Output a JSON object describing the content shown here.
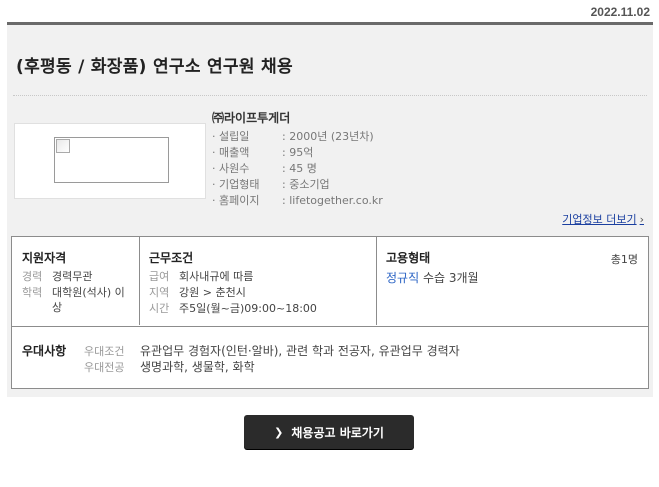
{
  "date": "2022.11.02",
  "job_title": "(후평동 / 화장품) 연구소 연구원 채용",
  "company": {
    "name": "㈜라이프투게더",
    "info": [
      {
        "label": "· 설립일",
        "value": ": 2000년 (23년차)"
      },
      {
        "label": "· 매출액",
        "value": ": 95억"
      },
      {
        "label": "· 사원수",
        "value": ": 45 명"
      },
      {
        "label": "· 기업형태",
        "value": ": 중소기업"
      },
      {
        "label": "· 홈페이지",
        "value": ": lifetogether.co.kr"
      }
    ],
    "link_label": "기업정보 더보기"
  },
  "qualifications": {
    "title": "지원자격",
    "career_label": "경력",
    "career_value": "경력무관",
    "education_label": "학력",
    "education_value": "대학원(석사) 이상"
  },
  "conditions": {
    "title": "근무조건",
    "salary_label": "급여",
    "salary_value": "회사내규에 따름",
    "region_label": "지역",
    "region_value": "강원 > 춘천시",
    "time_label": "시간",
    "time_value": "주5일(월~금)09:00~18:00"
  },
  "employment": {
    "title": "고용형태",
    "count": "총1명",
    "type": "정규직",
    "probation": "수습 3개월"
  },
  "preference": {
    "title": "우대사항",
    "condition_label": "우대조건",
    "condition_value": "유관업무 경험자(인턴·알바), 관련 학과 전공자, 유관업무 경력자",
    "major_label": "우대전공",
    "major_value": "생명과학, 생물학, 화학"
  },
  "cta_label": "채용공고 바로가기"
}
